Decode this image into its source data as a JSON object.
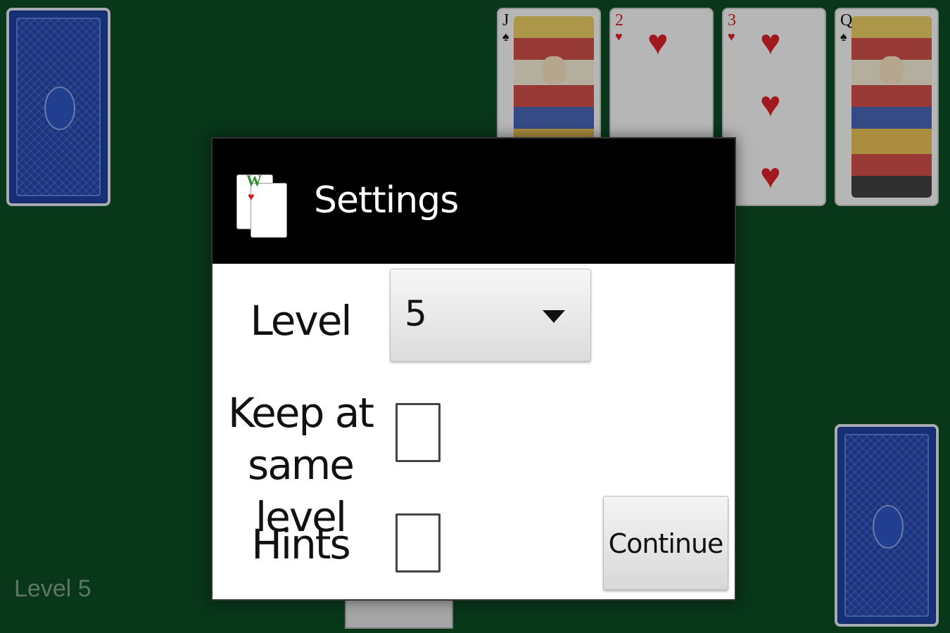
{
  "game": {
    "status_text": "Level 5",
    "cards": [
      {
        "rank": "J",
        "suit": "♠",
        "color": "black",
        "court": true
      },
      {
        "rank": "2",
        "suit": "♥",
        "color": "red",
        "court": false
      },
      {
        "rank": "3",
        "suit": "♥",
        "color": "red",
        "court": false
      },
      {
        "rank": "Q",
        "suit": "♠",
        "color": "black",
        "court": true
      }
    ]
  },
  "dialog": {
    "title": "Settings",
    "icon": "solitaire-app-icon",
    "icon_text": "W",
    "level_label": "Level",
    "level_value": "5",
    "keep_label_line1": "Keep at",
    "keep_label_line2": "same level",
    "keep_checked": false,
    "hints_label": "Hints",
    "hints_checked": false,
    "continue_label": "Continue"
  },
  "colors": {
    "table_green": "#0b4a23",
    "card_back_blue": "#1f3f9e",
    "heart_red": "#d8202a",
    "header_black": "#000000"
  }
}
